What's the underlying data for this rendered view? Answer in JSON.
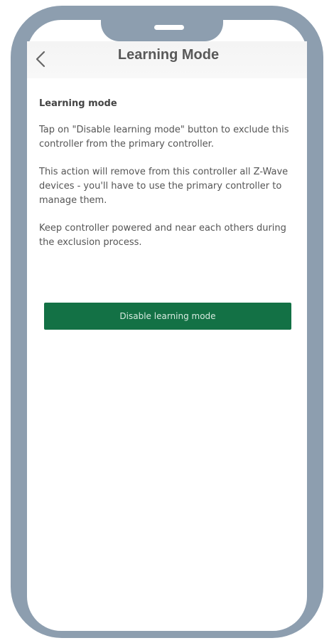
{
  "header": {
    "title": "Learning Mode",
    "back_icon": "chevron-left-icon"
  },
  "content": {
    "heading": "Learning mode",
    "paragraphs": [
      "Tap on \"Disable learning mode\" button to exclude this controller from the primary controller.",
      "This action will remove from this controller all Z-Wave devices - you'll have to use the primary controller to manage them.",
      "Keep controller powered and near each others during the exclusion process."
    ]
  },
  "action": {
    "disable_label": "Disable learning mode"
  },
  "colors": {
    "frame": "#8d9eaf",
    "button": "#137145",
    "title_text": "#595959",
    "body_text": "#555555"
  }
}
